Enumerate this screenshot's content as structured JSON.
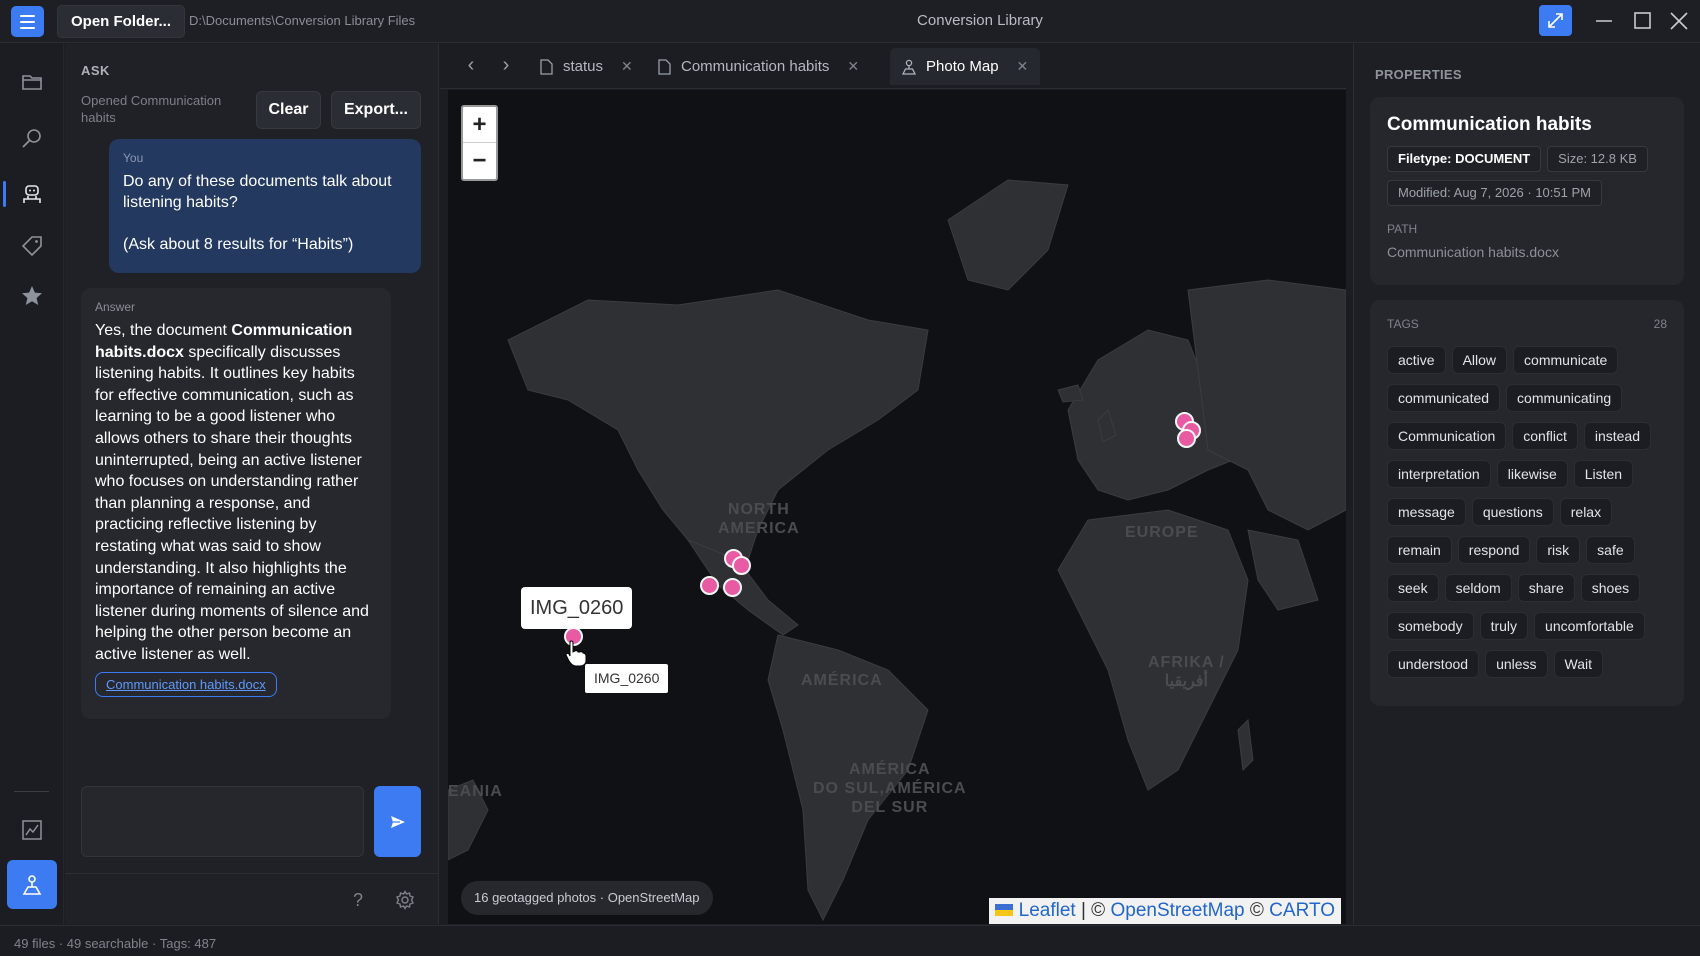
{
  "titlebar": {
    "open_folder_label": "Open Folder...",
    "path": "D:\\Documents\\Conversion Library Files",
    "app_title": "Conversion Library"
  },
  "ask": {
    "title": "ASK",
    "status": "Opened Communication habits",
    "clear_label": "Clear",
    "export_label": "Export...",
    "you_label": "You",
    "question": "Do any of these documents talk about listening habits?\n\n(Ask about 8 results for “Habits”)",
    "answer_label": "Answer",
    "answer_prefix": "Yes, the document ",
    "answer_doc": "Communication habits.docx",
    "answer_body": " specifically discusses listening habits. It outlines key habits for effective communication, such as learning to be a good listener who allows others to share their thoughts uninterrupted, being an active listener who focuses on understanding rather than planning a response, and practicing reflective listening by restating what was said to show understanding. It also highlights the importance of remaining an active listener during moments of silence and helping the other person become an active listener as well.",
    "source_link": "Communication habits.docx",
    "input_placeholder": ""
  },
  "tabs": [
    {
      "label": "status",
      "icon": "file-icon"
    },
    {
      "label": "Communication habits",
      "icon": "file-icon"
    },
    {
      "label": "Photo Map",
      "icon": "map-pin-icon"
    }
  ],
  "map": {
    "zoom_in": "+",
    "zoom_out": "−",
    "labels": {
      "north_america": "NORTH\nAMERICA",
      "europe": "EUROPE",
      "africa": "AFRIKA /\nأفريقيا",
      "america": "AMÉRICA",
      "south_america": "AMÉRICA\nDO SUL,AMÉRICA\nDEL SUR",
      "oceania": "EANIA"
    },
    "tooltip_big": "IMG_0260",
    "tooltip_small": "IMG_0260",
    "chip": "16 geotagged photos · OpenStreetMap",
    "attribution_leaflet": "Leaflet",
    "attribution_osm": "OpenStreetMap",
    "attribution_carto": "CARTO",
    "attribution_sep": " | © ",
    "attribution_sep2": " © ",
    "marker_color": "#e85aa2"
  },
  "properties": {
    "title": "PROPERTIES",
    "name": "Communication habits",
    "filetype": "Filetype: DOCUMENT",
    "size": "Size: 12.8 KB",
    "modified": "Modified: Aug 7, 2026 · 10:51 PM",
    "path_label": "PATH",
    "path": "Communication habits.docx",
    "tags_label": "TAGS",
    "tags_count": "28",
    "tags": [
      "active",
      "Allow",
      "communicate",
      "communicated",
      "communicating",
      "Communication",
      "conflict",
      "instead",
      "interpretation",
      "likewise",
      "Listen",
      "message",
      "questions",
      "relax",
      "remain",
      "respond",
      "risk",
      "safe",
      "seek",
      "seldom",
      "share",
      "shoes",
      "somebody",
      "truly",
      "uncomfortable",
      "understood",
      "unless",
      "Wait"
    ]
  },
  "statusbar": {
    "text": "49 files · 49 searchable · Tags: 487"
  },
  "colors": {
    "accent": "#3d7bf3",
    "background": "#1b1d22",
    "marker": "#e85aa2"
  }
}
